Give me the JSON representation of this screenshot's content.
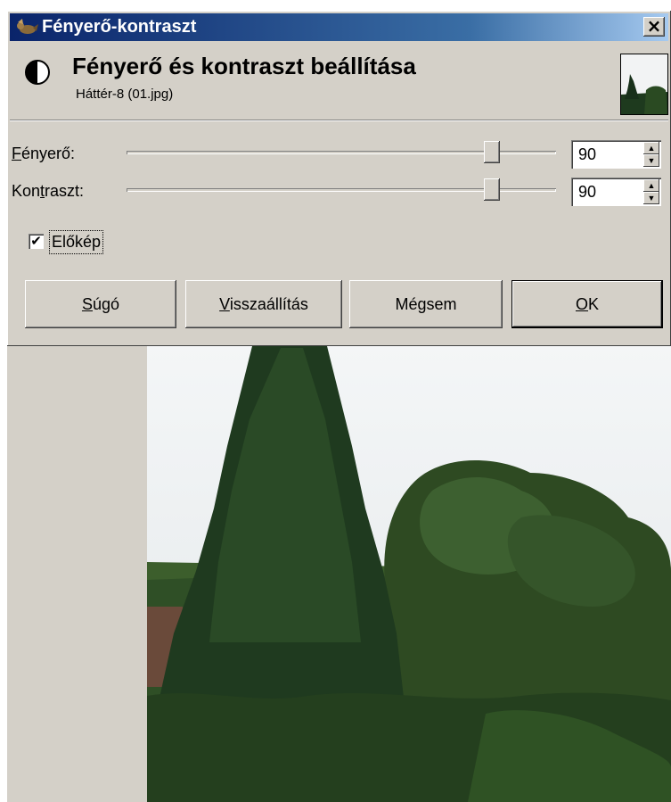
{
  "window": {
    "title": "Fényerő-kontraszt",
    "close_label": "×"
  },
  "header": {
    "title": "Fényerő és kontraszt beállítása",
    "subtitle": "Háttér-8 (01.jpg)"
  },
  "controls": {
    "brightness": {
      "label_mnemonic": "F",
      "label_rest": "ényerő:",
      "value": "90",
      "slider_fraction": 0.85
    },
    "contrast": {
      "label_pre": "Kon",
      "label_mnemonic": "t",
      "label_post": "raszt:",
      "value": "90",
      "slider_fraction": 0.85
    },
    "preview": {
      "label": "Előkép",
      "checked": true
    }
  },
  "buttons": {
    "help": {
      "mnemonic": "S",
      "rest": "úgó"
    },
    "reset": {
      "mnemonic": "V",
      "rest": "isszaállítás"
    },
    "cancel": {
      "pre": "Mé",
      "mnemonic": "g",
      "post": "sem"
    },
    "ok": {
      "mnemonic": "O",
      "rest": "K"
    }
  },
  "icons": {
    "title": "gimp-wilber-icon",
    "header": "brightness-contrast-icon",
    "thumbnail": "image-thumbnail",
    "spin_up": "spin-up-arrow-icon",
    "spin_down": "spin-down-arrow-icon",
    "check": "checkmark-icon"
  },
  "colors": {
    "titlebar_start": "#0a246a",
    "titlebar_end": "#a6caf0",
    "dialog_bg": "#d4d0c8"
  }
}
